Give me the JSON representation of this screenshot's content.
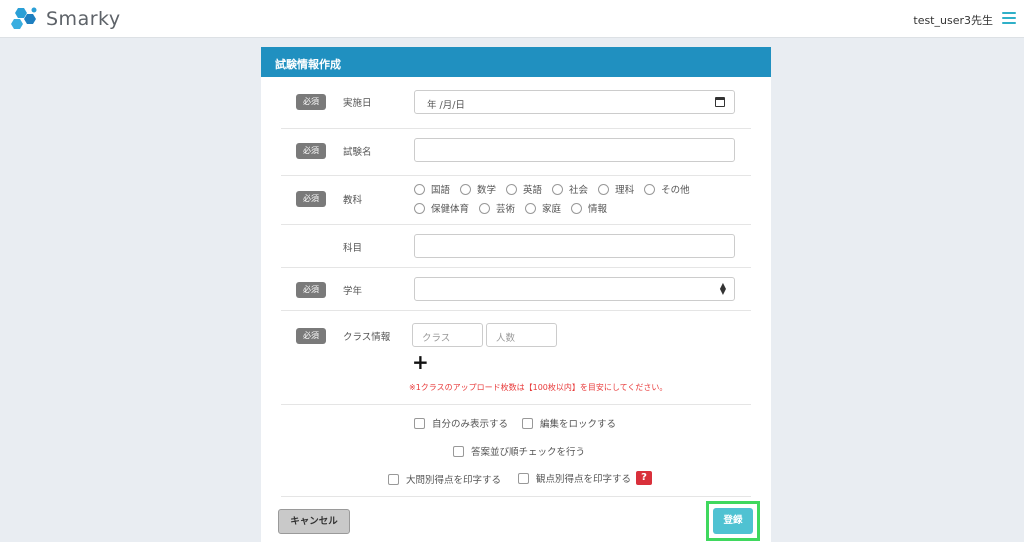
{
  "header": {
    "app_name": "Smarky",
    "user_label": "test_user3先生"
  },
  "form": {
    "title": "試験情報作成",
    "required_badge": "必須",
    "fields": {
      "date_label": "実施日",
      "date_placeholder": "年 /月/日",
      "exam_name_label": "試験名",
      "subject_group_label": "教科",
      "subject_label": "科目",
      "grade_label": "学年",
      "class_info_label": "クラス情報"
    },
    "subject_options_row1": [
      "国語",
      "数学",
      "英語",
      "社会",
      "理科",
      "その他"
    ],
    "subject_options_row2": [
      "保健体育",
      "芸術",
      "家庭",
      "情報"
    ],
    "class_placeholder": "クラス",
    "people_placeholder": "人数",
    "add_symbol": "+",
    "note": "※1クラスのアップロード枚数は【100枚以内】を目安にしてください。",
    "options": {
      "show_only_me": "自分のみ表示する",
      "lock_edit": "編集をロックする",
      "answer_order_check": "答案並び順チェックを行う",
      "print_question_scores": "大問別得点を印字する",
      "print_viewpoint_scores": "観点別得点を印字する",
      "help": "?"
    },
    "buttons": {
      "cancel": "キャンセル",
      "submit": "登録"
    }
  },
  "colors": {
    "header_bar": "#2090c0",
    "submit": "#4fc2d2",
    "highlight": "#3fd85e",
    "note": "#e83a3a"
  }
}
